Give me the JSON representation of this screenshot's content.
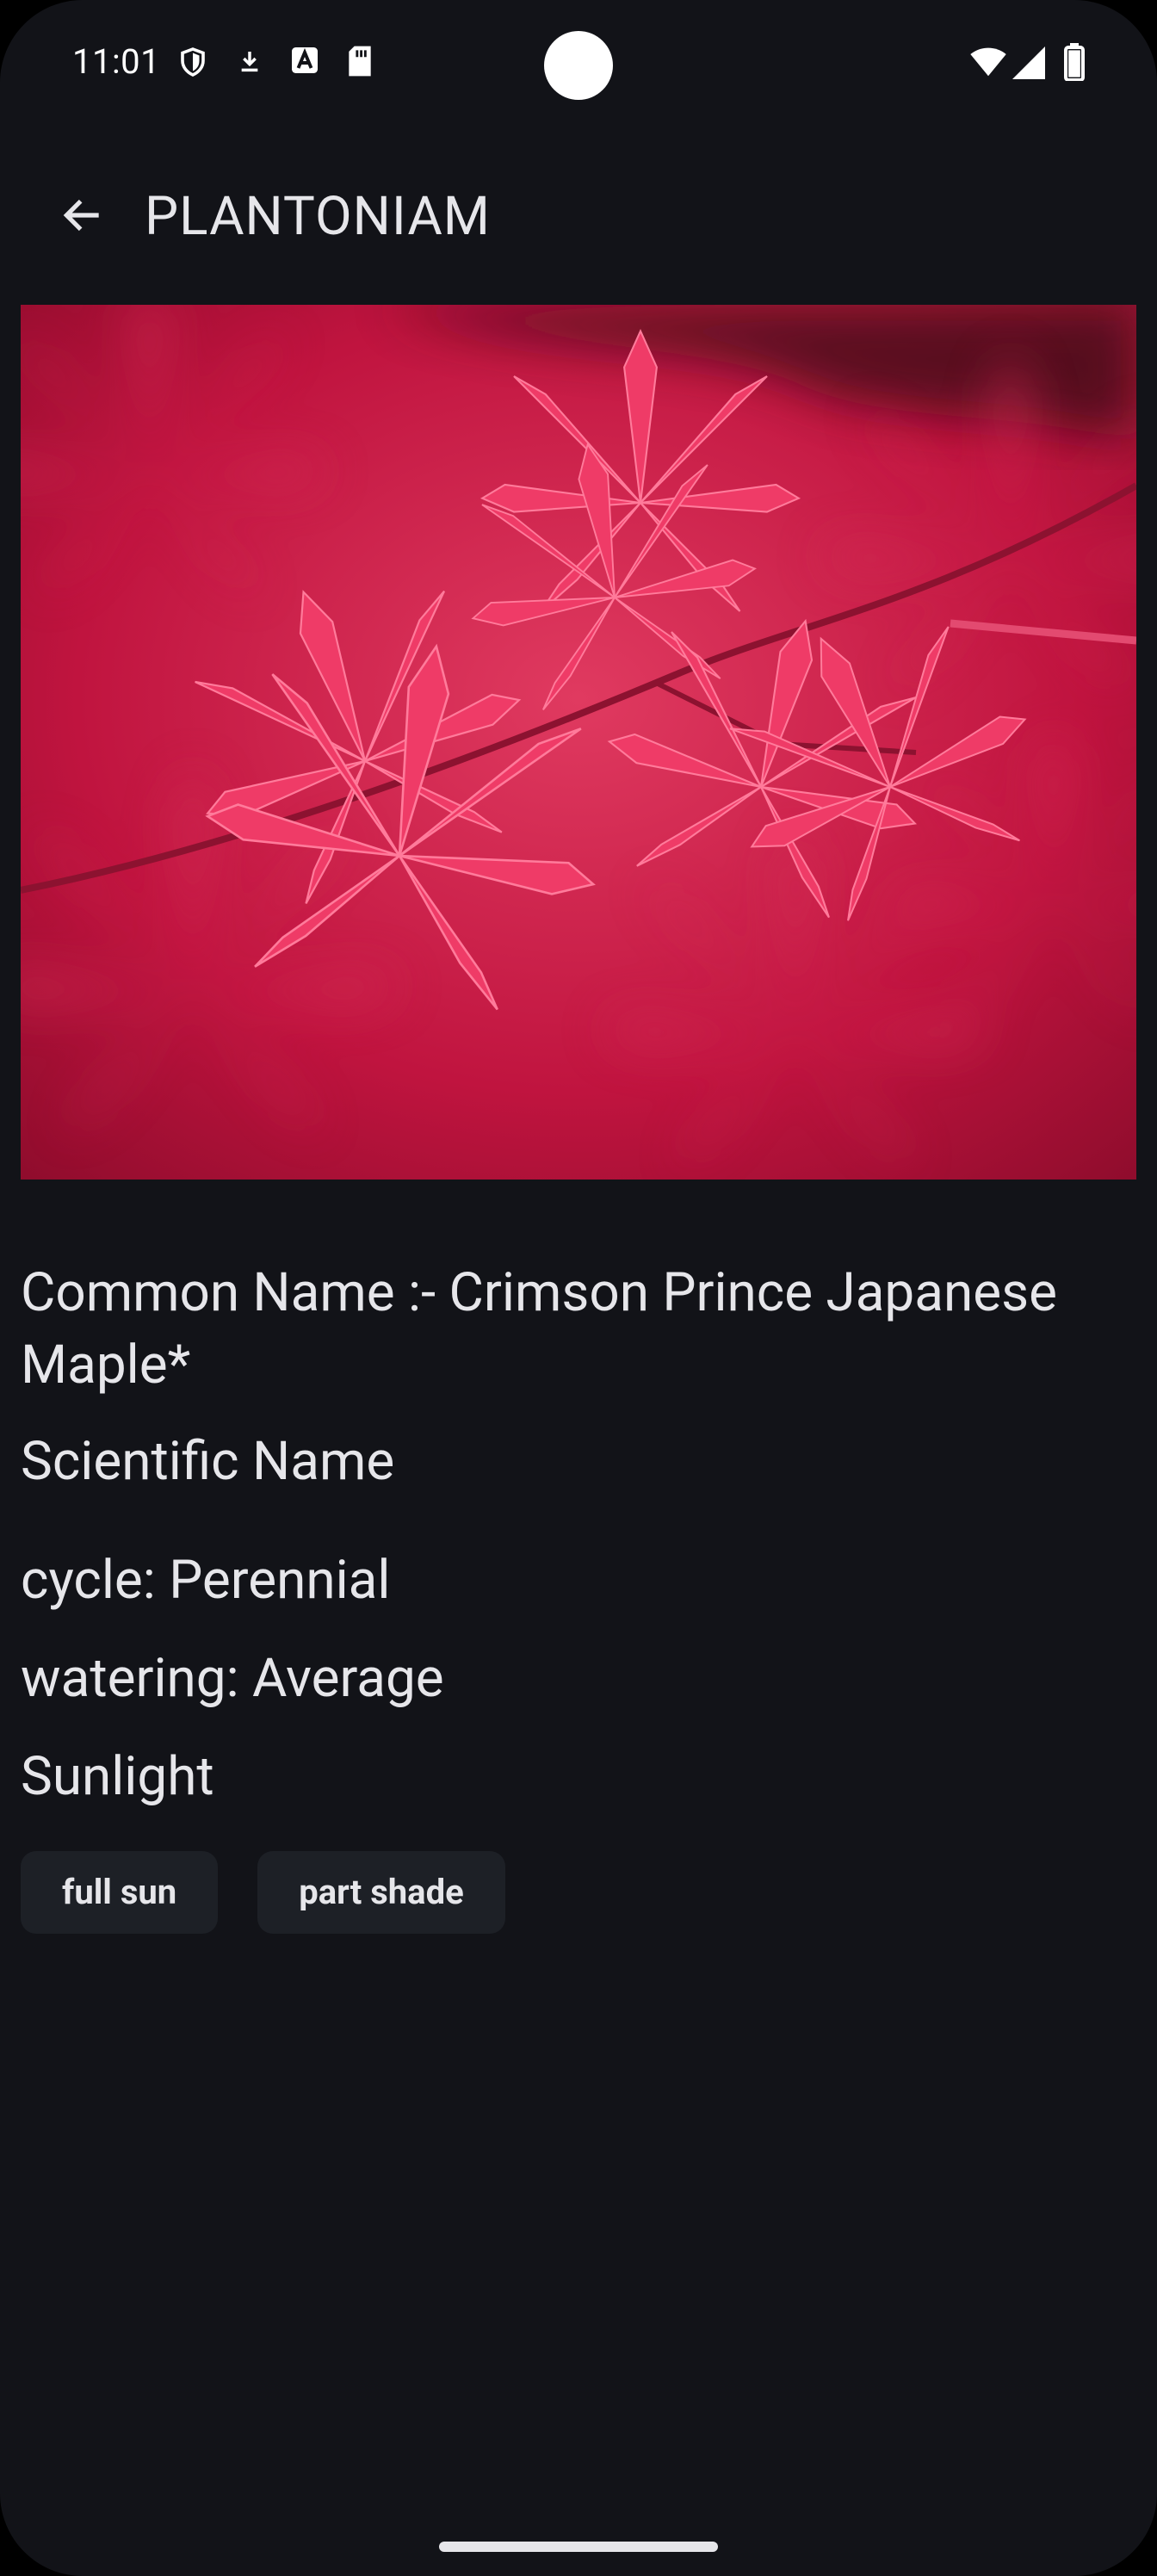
{
  "status_bar": {
    "time": "11:01",
    "left_icons": [
      "shield-icon",
      "download-arrow-icon",
      "keyboard-a-icon",
      "sd-card-icon"
    ],
    "right_icons": [
      "wifi-icon",
      "signal-icon",
      "battery-icon"
    ]
  },
  "app_bar": {
    "back_icon": "arrow-back-icon",
    "title": "PLANTONIAM"
  },
  "plant": {
    "image_subject": "red japanese maple leaves",
    "common_name": "Common Name :- Crimson Prince Japanese Maple*",
    "scientific_name_label": "Scientific Name",
    "cycle": "cycle: Perennial",
    "watering": "watering: Average",
    "sunlight_label": "Sunlight",
    "sunlight_chips": [
      "full sun",
      "part shade"
    ]
  },
  "colors": {
    "background": "#121318",
    "text": "#e6e6ea",
    "chip_background": "#1d2026",
    "leaf_red": "#e8315f"
  }
}
